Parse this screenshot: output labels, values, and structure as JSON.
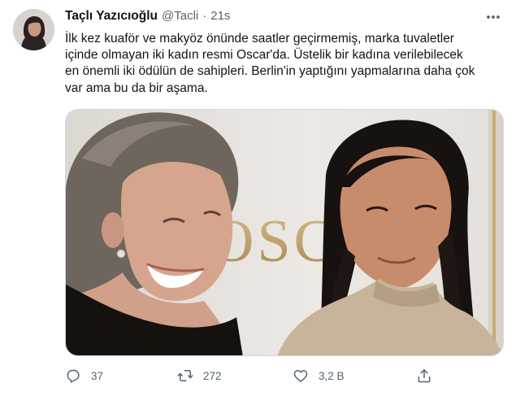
{
  "tweet": {
    "author": {
      "display_name": "Taçlı Yazıcıoğlu",
      "handle": "@Tacli",
      "separator": "·",
      "timestamp": "21s"
    },
    "text": "İlk kez kuaför ve makyöz önünde saatler geçirmemiş, marka tuvaletler\niçinde olmayan iki kadın resmi Oscar'da. Üstelik bir kadına verilebilecek\nen önemli iki ödülün de sahipleri. Berlin'in yaptığını yapmalarına daha çok\nvar ama bu da bir aşama.",
    "media": {
      "backdrop_text": "OSCA"
    },
    "actions": {
      "reply_count": "37",
      "retweet_count": "272",
      "like_count": "3,2 B"
    }
  },
  "icons": {
    "more": "more-horizontal-icon",
    "reply": "reply-icon",
    "retweet": "retweet-icon",
    "like": "heart-icon",
    "share": "share-icon"
  },
  "colors": {
    "text": "#0f1419",
    "secondary": "#536471",
    "border": "#cfd9de",
    "backdrop_gold": "#b99a63"
  }
}
